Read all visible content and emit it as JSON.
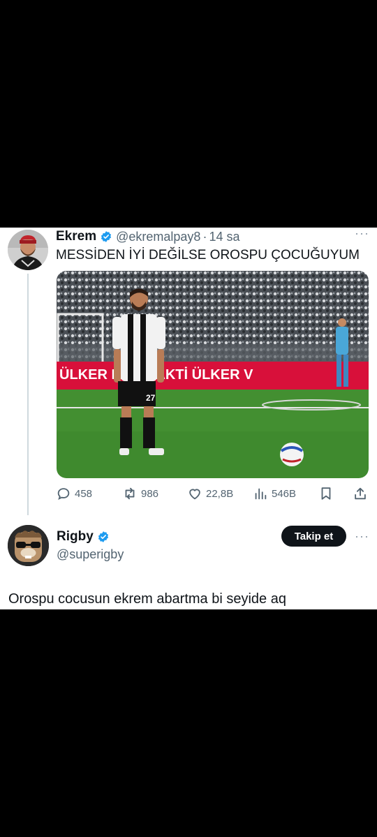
{
  "tweet": {
    "author_name": "Ekrem",
    "handle": "@ekremalpay8",
    "separator": "·",
    "time": "14 sa",
    "text": "MESSİDEN İYİ DEĞİLSE OROSPU ÇOCUĞUYUM",
    "photo": {
      "ad_board_text": "ÜLKER   MAÇ VAKTİ  ÜLKER V",
      "jersey_number": "27"
    },
    "metrics": {
      "replies": "458",
      "reposts": "986",
      "likes": "22,8B",
      "views": "546B"
    }
  },
  "reply": {
    "author_name": "Rigby",
    "handle": "@superigby",
    "follow_label": "Takip et",
    "text": "Orospu cocusun ekrem abartma bi seyide aq"
  },
  "colors": {
    "verified": "#1d9bf0",
    "text": "#0f1419",
    "muted": "#536471",
    "button": "#0f1419"
  },
  "icons": [
    "verified-badge-icon",
    "more-icon",
    "reply-icon",
    "repost-icon",
    "like-icon",
    "views-icon",
    "bookmark-icon",
    "share-icon"
  ]
}
